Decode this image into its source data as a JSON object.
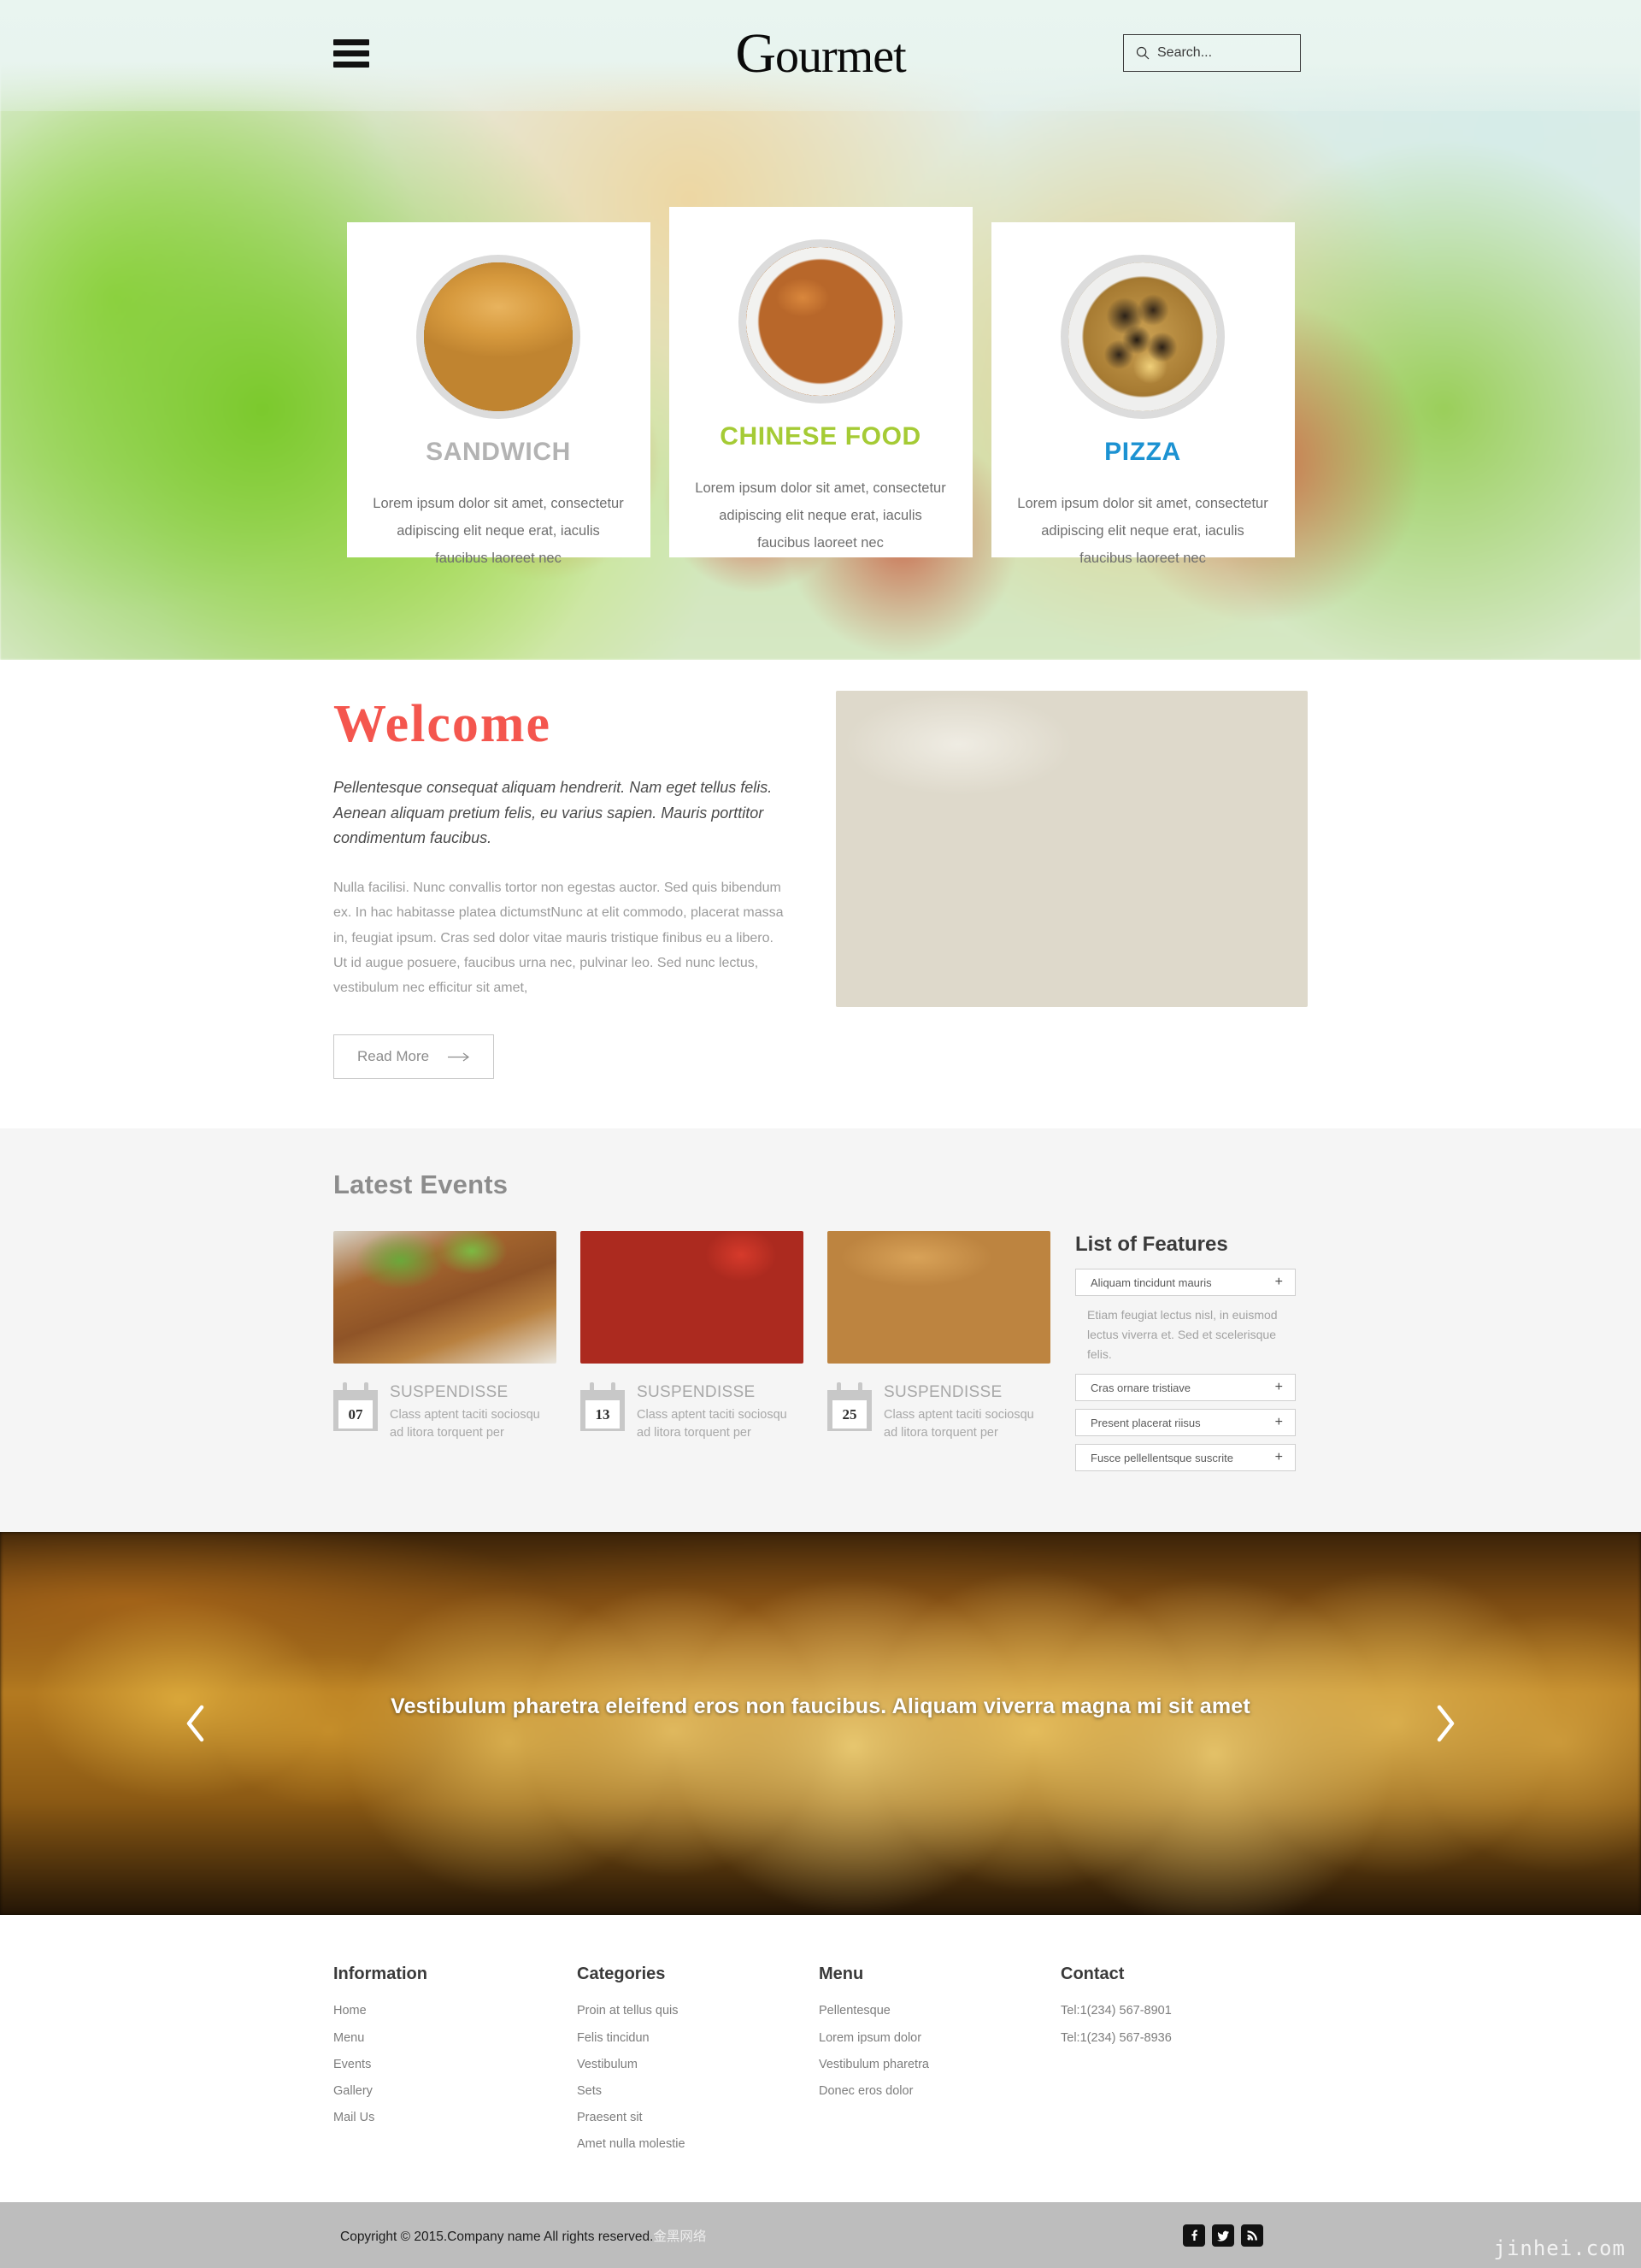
{
  "header": {
    "brand_first": "G",
    "brand_rest": "ourmet",
    "menu_icon": "hamburger-icon",
    "search": {
      "placeholder": "Search...",
      "value": "",
      "icon": "search-icon"
    }
  },
  "hero_cards": [
    {
      "title": "SANDWICH",
      "color": "#b3b3b3",
      "image": "sandwich-photo",
      "desc": "Lorem ipsum dolor sit amet, consectetur adipiscing elit neque erat, iaculis faucibus laoreet nec"
    },
    {
      "title": "CHINESE FOOD",
      "color": "#a5cb35",
      "image": "chinese-food-photo",
      "desc": "Lorem ipsum dolor sit amet, consectetur adipiscing elit neque erat, iaculis faucibus laoreet nec"
    },
    {
      "title": "PIZZA",
      "color": "#1c92d2",
      "image": "pizza-photo",
      "desc": "Lorem ipsum dolor sit amet, consectetur adipiscing elit neque erat, iaculis faucibus laoreet nec"
    }
  ],
  "welcome": {
    "title": "Welcome",
    "title_color": "#f4564e",
    "lead": "Pellentesque consequat aliquam hendrerit. Nam eget tellus felis. Aenean aliquam pretium felis, eu varius sapien. Mauris porttitor condimentum faucibus.",
    "body": "Nulla facilisi. Nunc convallis tortor non egestas auctor. Sed quis bibendum ex. In hac habitasse platea dictumstNunc at elit commodo, placerat massa in, feugiat ipsum. Cras sed dolor vitae mauris tristique finibus eu a libero. Ut id augue posuere, faucibus urna nec, pulvinar leo. Sed nunc lectus, vestibulum nec efficitur sit amet,",
    "read_more": "Read More",
    "read_more_icon": "arrow-right-icon",
    "image": "beef-stew-photo"
  },
  "events": {
    "title": "Latest Events",
    "items": [
      {
        "day": "07",
        "name": "SUSPENDISSE",
        "desc": "Class aptent taciti sociosqu ad litora torquent per",
        "image": "roast-duck-photo"
      },
      {
        "day": "13",
        "name": "SUSPENDISSE",
        "desc": "Class aptent taciti sociosqu ad litora torquent per",
        "image": "beef-stew-photo"
      },
      {
        "day": "25",
        "name": "SUSPENDISSE",
        "desc": "Class aptent taciti sociosqu ad litora torquent per",
        "image": "burger-fries-photo"
      }
    ]
  },
  "features": {
    "title": "List of Features",
    "expand_icon": "plus-icon",
    "items": [
      {
        "label": "Aliquam tincidunt mauris",
        "expanded": true,
        "body": "Etiam feugiat lectus nisl, in euismod lectus viverra et. Sed et scelerisque felis."
      },
      {
        "label": "Cras ornare tristiave",
        "expanded": false,
        "body": ""
      },
      {
        "label": "Present placerat riisus",
        "expanded": false,
        "body": ""
      },
      {
        "label": "Fusce pellellentsque suscrite",
        "expanded": false,
        "body": ""
      }
    ]
  },
  "carousel": {
    "caption": "Vestibulum pharetra eleifend eros non faucibus. Aliquam viverra magna mi sit amet",
    "prev_icon": "chevron-left-icon",
    "next_icon": "chevron-right-icon",
    "image": "wine-glasses-photo"
  },
  "footer": {
    "columns": [
      {
        "heading": "Information",
        "links": [
          "Home",
          "Menu",
          "Events",
          "Gallery",
          "Mail Us"
        ]
      },
      {
        "heading": "Categories",
        "links": [
          "Proin at tellus quis",
          "Felis tincidun",
          "Vestibulum",
          "Sets",
          "Praesent sit",
          "Amet nulla molestie"
        ]
      },
      {
        "heading": "Menu",
        "links": [
          "Pellentesque",
          "Lorem ipsum dolor",
          "Vestibulum pharetra",
          "Donec eros dolor"
        ]
      },
      {
        "heading": "Contact",
        "links": [
          "Tel:1(234) 567-8901",
          "Tel:1(234) 567-8936"
        ]
      }
    ],
    "copyright": "Copyright © 2015.Company name All rights reserved.",
    "copyright_suffix": "金黑网络",
    "socials": [
      "facebook-icon",
      "twitter-icon",
      "rss-icon"
    ],
    "watermark": "jinhei.com"
  }
}
